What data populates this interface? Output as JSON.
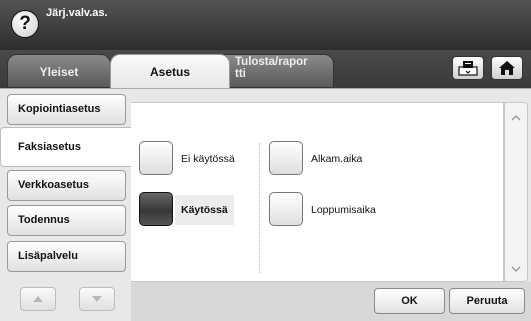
{
  "window": {
    "title": "Järj.valv.as."
  },
  "tabs": [
    {
      "label": "Yleiset"
    },
    {
      "label": "Asetus"
    },
    {
      "label": "Tulosta/raportti",
      "line1": "Tulosta/rapor",
      "line2": "tti"
    }
  ],
  "toolbar": {
    "job_icon": "job-status-icon",
    "home_icon": "home-icon"
  },
  "sidebar": {
    "items": [
      {
        "label": "Kopiointiasetus"
      },
      {
        "label": "Faksiasetus",
        "selected": true
      },
      {
        "label": "Verkkoasetus"
      },
      {
        "label": "Todennus"
      },
      {
        "label": "Lisäpalvelu"
      }
    ]
  },
  "options": [
    {
      "label": "Ei käytössä",
      "checked": false
    },
    {
      "label": "Käytössä",
      "checked": true
    },
    {
      "label": "Alkam.aika",
      "checked": false
    },
    {
      "label": "Loppumisaika",
      "checked": false
    }
  ],
  "actions": {
    "ok": "OK",
    "cancel": "Peruuta"
  },
  "colors": {
    "titlebar": "#3d3d3d",
    "content_bg": "#e8e8e8",
    "checked": "#444444"
  }
}
